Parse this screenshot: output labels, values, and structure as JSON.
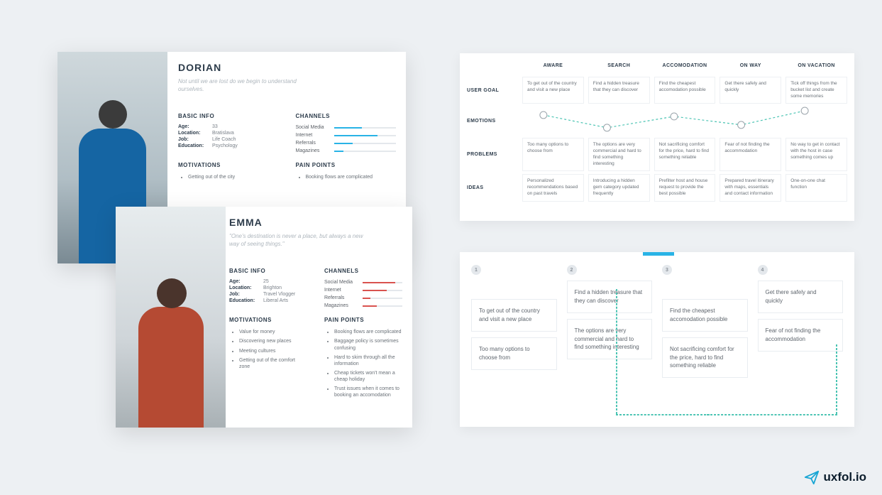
{
  "personas": {
    "dorian": {
      "name": "DORIAN",
      "quote": "Not until we are lost do we begin to understand ourselves.",
      "basic_info_h": "BASIC INFO",
      "channels_h": "CHANNELS",
      "motivations_h": "MOTIVATIONS",
      "painpoints_h": "PAIN POINTS",
      "info": {
        "age_k": "Age:",
        "age_v": "33",
        "loc_k": "Location:",
        "loc_v": "Bratislava",
        "job_k": "Job:",
        "job_v": "Life Coach",
        "edu_k": "Education:",
        "edu_v": "Psychology"
      },
      "channels": [
        {
          "label": "Social Media",
          "pct": 45
        },
        {
          "label": "Internet",
          "pct": 70
        },
        {
          "label": "Referrals",
          "pct": 30
        },
        {
          "label": "Magazines",
          "pct": 15
        }
      ],
      "motivations": [
        "Getting out of the city"
      ],
      "painpoints": [
        "Booking flows are complicated"
      ]
    },
    "emma": {
      "name": "EMMA",
      "quote": "\"One's destination is never a place, but always a new way of seeing things.\"",
      "basic_info_h": "BASIC INFO",
      "channels_h": "CHANNELS",
      "motivations_h": "MOTIVATIONS",
      "painpoints_h": "PAIN POINTS",
      "info": {
        "age_k": "Age:",
        "age_v": "25",
        "loc_k": "Location:",
        "loc_v": "Brighton",
        "job_k": "Job:",
        "job_v": "Travel Vlogger",
        "edu_k": "Education:",
        "edu_v": "Liberal Arts"
      },
      "channels": [
        {
          "label": "Social Media",
          "pct": 82
        },
        {
          "label": "Internet",
          "pct": 60
        },
        {
          "label": "Referrals",
          "pct": 20
        },
        {
          "label": "Magazines",
          "pct": 35
        }
      ],
      "motivations": [
        "Value for money",
        "Discovering new places",
        "Meeting cultures",
        "Getting out of the comfort zone"
      ],
      "painpoints": [
        "Booking flows are complicated",
        "Baggage policy is sometimes confusing",
        "Hard to skim through all the information",
        "Cheap tickets won't mean a cheap holiday",
        "Trust issues when it comes to booking an accomodation"
      ]
    }
  },
  "journey": {
    "cols": [
      "AWARE",
      "SEARCH",
      "ACCOMODATION",
      "ON WAY",
      "ON VACATION"
    ],
    "rows": [
      "USER GOAL",
      "EMOTIONS",
      "PROBLEMS",
      "IDEAS"
    ],
    "user_goal": [
      "To get out of the country and visit a new place",
      "Find a hidden treasure that they can discover",
      "Find the cheapest accomodation possible",
      "Get there safely and quickly",
      "Tick off things from the bucket list and create some memories"
    ],
    "problems": [
      "Too many options to choose from",
      "The options are very commercial and hard to find something interesting",
      "Not sacrificing comfort for the price, hard to find something reliable",
      "Fear of not finding the accommodation",
      "No way to get in contact with the host in case something comes up"
    ],
    "ideas": [
      "Personalized recommendations based on past travels",
      "Introducing a hidden gem category updated frequently",
      "Prefilter host and house request to provide the best possible",
      "Prepared travel itinerary with maps, essentials and contact information",
      "One-on-one chat function"
    ]
  },
  "storyboard": {
    "steps": [
      "1",
      "2",
      "3",
      "4"
    ],
    "cards": {
      "c1a": "To get out of the country and visit a new place",
      "c1b": "Too many options to choose from",
      "c2a": "Find a hidden treasure that they can discover",
      "c2b": "The options are very commercial and hard to find something interesting",
      "c3a": "Find the cheapest accomodation possible",
      "c3b": "Not sacrificing comfort for the price, hard to find something reliable",
      "c4a": "Get there safely and quickly",
      "c4b": "Fear of not finding the accommodation"
    }
  },
  "brand": {
    "name": "uxfol.io"
  }
}
